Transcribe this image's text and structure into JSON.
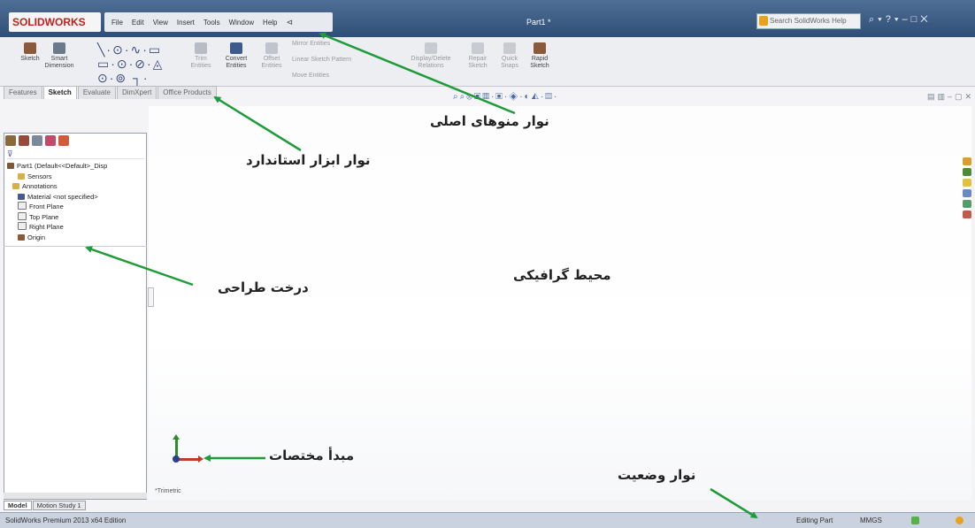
{
  "app": {
    "logo": "SOLIDWORKS",
    "menu": [
      "File",
      "Edit",
      "View",
      "Insert",
      "Tools",
      "Window",
      "Help"
    ],
    "doc_title": "Part1 *",
    "help_placeholder": "Search SolidWorks Help"
  },
  "toolbar": {
    "sketch": "Sketch",
    "smart_dimension": "Smart Dimension",
    "trim": "Trim Entities",
    "convert": "Convert Entities",
    "offset": "Offset Entities",
    "mirror": "Mirror Entities",
    "linear_pattern": "Linear Sketch Pattern",
    "move": "Move Entities",
    "display_delete": "Display/Delete Relations",
    "repair": "Repair Sketch",
    "quick_snaps": "Quick Snaps",
    "rapid_sketch": "Rapid Sketch"
  },
  "tabs": [
    "Features",
    "Sketch",
    "Evaluate",
    "DimXpert",
    "Office Products"
  ],
  "tree": {
    "items": [
      "Part1 (Default<<Default>_Disp",
      "Sensors",
      "Annotations",
      "Material <not specified>",
      "Front Plane",
      "Top Plane",
      "Right Plane",
      "Origin"
    ]
  },
  "graphics": {
    "view_label": "*Trimetric"
  },
  "bottom_tabs": [
    "Model",
    "Motion Study 1"
  ],
  "status": {
    "left": "SolidWorks Premium 2013 x64 Edition",
    "editing": "Editing Part",
    "units": "MMGS"
  },
  "annotations": {
    "main_menu": "نوار منوهای اصلی",
    "standard_toolbar": "نوار ابزار استاندارد",
    "design_tree": "درخت طراحی",
    "graphics_area": "محیط گرافیکی",
    "coordinate_origin": "مبدأ مختصات",
    "status_bar": "نوار وضعیت"
  },
  "colors": {
    "title_bar": "#2f4e77",
    "arrow": "#1f9b3a",
    "origin_x": "#c0392b",
    "origin_y": "#2e8b2e"
  }
}
